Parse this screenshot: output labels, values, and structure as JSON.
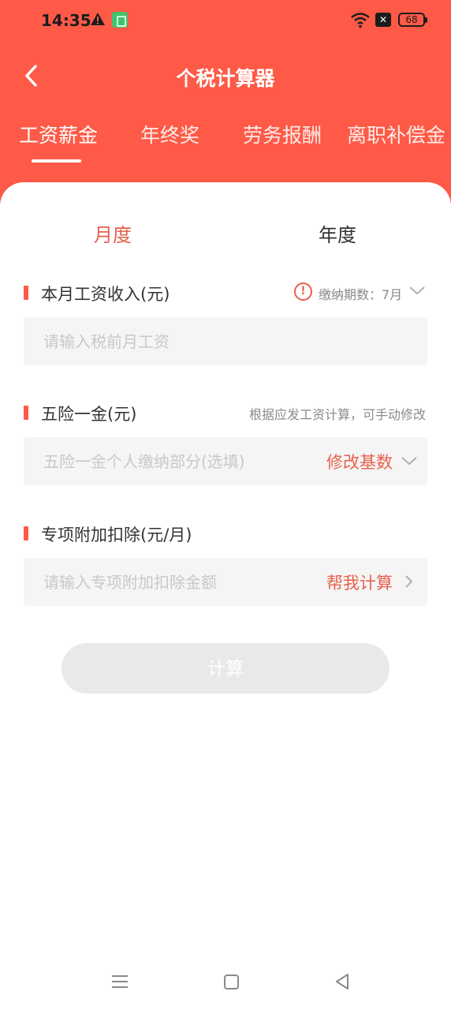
{
  "status": {
    "time": "14:35",
    "battery": "68"
  },
  "header": {
    "title": "个税计算器"
  },
  "tabs": [
    {
      "label": "工资薪金",
      "active": true
    },
    {
      "label": "年终奖",
      "active": false
    },
    {
      "label": "劳务报酬",
      "active": false
    },
    {
      "label": "离职补偿金",
      "active": false
    }
  ],
  "period_tabs": {
    "monthly": "月度",
    "yearly": "年度",
    "selected": "月度"
  },
  "income": {
    "title": "本月工资收入(元)",
    "period_label": "缴纳期数：7月",
    "placeholder": "请输入税前月工资"
  },
  "insurance": {
    "title": "五险一金(元)",
    "hint": "根据应发工资计算，可手动修改",
    "placeholder": "五险一金个人缴纳部分(选填)",
    "action": "修改基数"
  },
  "deduction": {
    "title": "专项附加扣除(元/月)",
    "placeholder": "请输入专项附加扣除金额",
    "action": "帮我计算"
  },
  "calculate_label": "计算",
  "colors": {
    "accent": "#fe5a47",
    "accent_text": "#e8604c",
    "input_bg": "#f5f5f5",
    "button_disabled": "#e9e9e9"
  }
}
